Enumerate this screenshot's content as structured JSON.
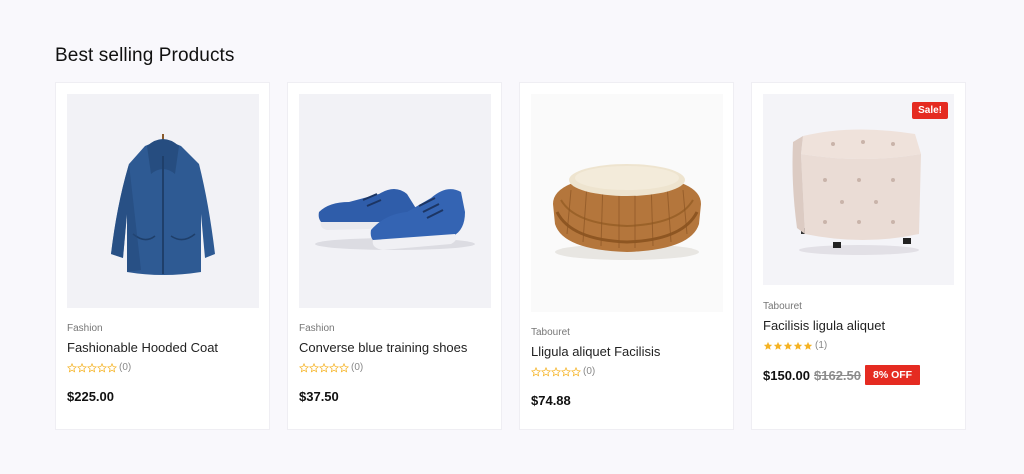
{
  "section": {
    "title": "Best selling Products"
  },
  "colors": {
    "accent": "#e52b21",
    "star": "#f5b324",
    "background": "#f9f8fc"
  },
  "products": [
    {
      "category": "Fashion",
      "name": "Fashionable Hooded Coat",
      "rating": 0,
      "reviews": "(0)",
      "price": "$225.00",
      "image_icon": "hooded-coat-image"
    },
    {
      "category": "Fashion",
      "name": "Converse blue training shoes",
      "rating": 0,
      "reviews": "(0)",
      "price": "$37.50",
      "image_icon": "sneakers-image"
    },
    {
      "category": "Tabouret",
      "name": "Lligula aliquet Facilisis",
      "rating": 0,
      "reviews": "(0)",
      "price": "$74.88",
      "image_icon": "pouf-image"
    },
    {
      "category": "Tabouret",
      "name": "Facilisis ligula aliquet",
      "rating": 5,
      "reviews": "(1)",
      "price": "$150.00",
      "old_price": "$162.50",
      "discount": "8% OFF",
      "sale_label": "Sale!",
      "image_icon": "tufted-ottoman-image"
    }
  ]
}
